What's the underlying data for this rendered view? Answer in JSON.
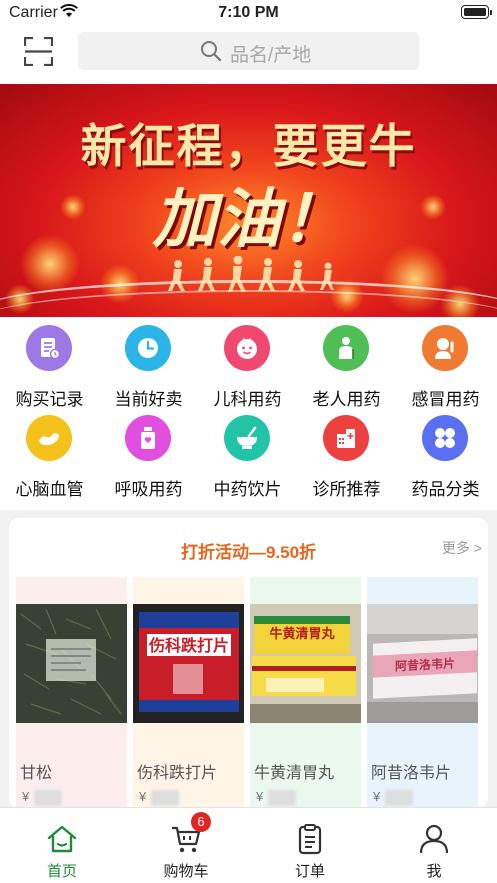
{
  "status_bar": {
    "carrier": "Carrier",
    "time": "7:10 PM"
  },
  "search": {
    "placeholder": "品名/产地",
    "scan_icon": "scan-icon",
    "search_icon": "search-icon"
  },
  "banner": {
    "headline": "新征程，要更牛",
    "slogan": "加油！"
  },
  "categories": [
    {
      "label": "购买记录",
      "icon": "receipt-icon",
      "color": "#9b7ae6"
    },
    {
      "label": "当前好卖",
      "icon": "clock-icon",
      "color": "#2bb4e8"
    },
    {
      "label": "儿科用药",
      "icon": "baby-icon",
      "color": "#f0486e"
    },
    {
      "label": "老人用药",
      "icon": "elder-icon",
      "color": "#4fbf55"
    },
    {
      "label": "感冒用药",
      "icon": "sick-person-icon",
      "color": "#f07a32"
    },
    {
      "label": "心脑血管",
      "icon": "heart-icon",
      "color": "#f4c21a"
    },
    {
      "label": "呼吸用药",
      "icon": "medicine-bottle-icon",
      "color": "#e04fe0"
    },
    {
      "label": "中药饮片",
      "icon": "mortar-icon",
      "color": "#22c4a8"
    },
    {
      "label": "诊所推荐",
      "icon": "clinic-icon",
      "color": "#ef4040"
    },
    {
      "label": "药品分类",
      "icon": "grid-icon",
      "color": "#5b6ff0"
    }
  ],
  "promo": {
    "title": "打折活动—9.50折",
    "more": "更多 >",
    "products": [
      {
        "name": "甘松",
        "currency": "¥",
        "bg": "#fdeeee"
      },
      {
        "name": "伤科跌打片",
        "currency": "¥",
        "bg": "#fff5e6"
      },
      {
        "name": "牛黄清胃丸",
        "currency": "¥",
        "bg": "#ebf8ee"
      },
      {
        "name": "阿昔洛韦片",
        "currency": "¥",
        "bg": "#e8f4fb"
      }
    ]
  },
  "tabbar": {
    "tabs": [
      {
        "label": "首页",
        "icon": "home-icon"
      },
      {
        "label": "购物车",
        "icon": "cart-icon",
        "badge": "6"
      },
      {
        "label": "订单",
        "icon": "order-icon"
      },
      {
        "label": "我",
        "icon": "user-icon"
      }
    ],
    "active_color": "#1f8a3a"
  }
}
